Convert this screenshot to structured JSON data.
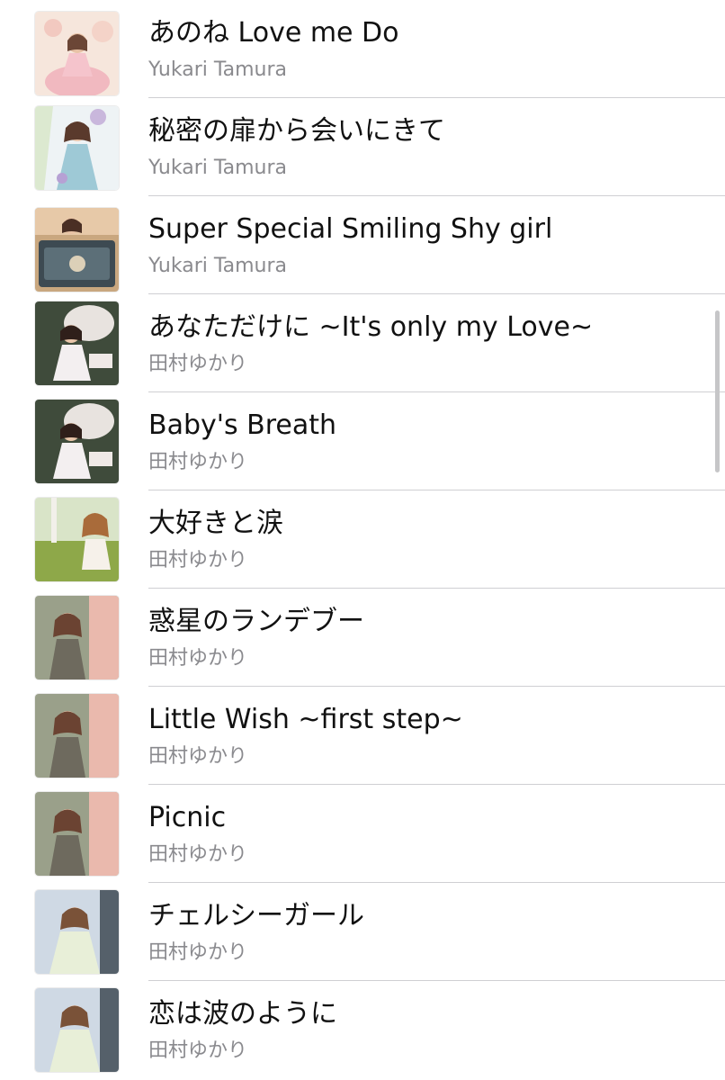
{
  "songs": [
    {
      "title": "あのね Love me Do",
      "artist": "Yukari Tamura",
      "art": "pink-dress-art"
    },
    {
      "title": "秘密の扉から会いにきて",
      "artist": "Yukari Tamura",
      "art": "blue-dress-art"
    },
    {
      "title": "Super Special Smiling Shy girl",
      "artist": "Yukari Tamura",
      "art": "trunk-art"
    },
    {
      "title": "あなただけに ~It's only my Love~",
      "artist": "田村ゆかり",
      "art": "parasol-art"
    },
    {
      "title": "Baby's Breath",
      "artist": "田村ゆかり",
      "art": "parasol-art"
    },
    {
      "title": "大好きと涙",
      "artist": "田村ゆかり",
      "art": "meadow-art"
    },
    {
      "title": "惑星のランデブー",
      "artist": "田村ゆかり",
      "art": "stairs-art"
    },
    {
      "title": "Little Wish ~first step~",
      "artist": "田村ゆかり",
      "art": "stairs-art"
    },
    {
      "title": "Picnic",
      "artist": "田村ゆかり",
      "art": "stairs-art"
    },
    {
      "title": "チェルシーガール",
      "artist": "田村ゆかり",
      "art": "portrait-art"
    },
    {
      "title": "恋は波のように",
      "artist": "田村ゆかり",
      "art": "portrait-art"
    }
  ]
}
